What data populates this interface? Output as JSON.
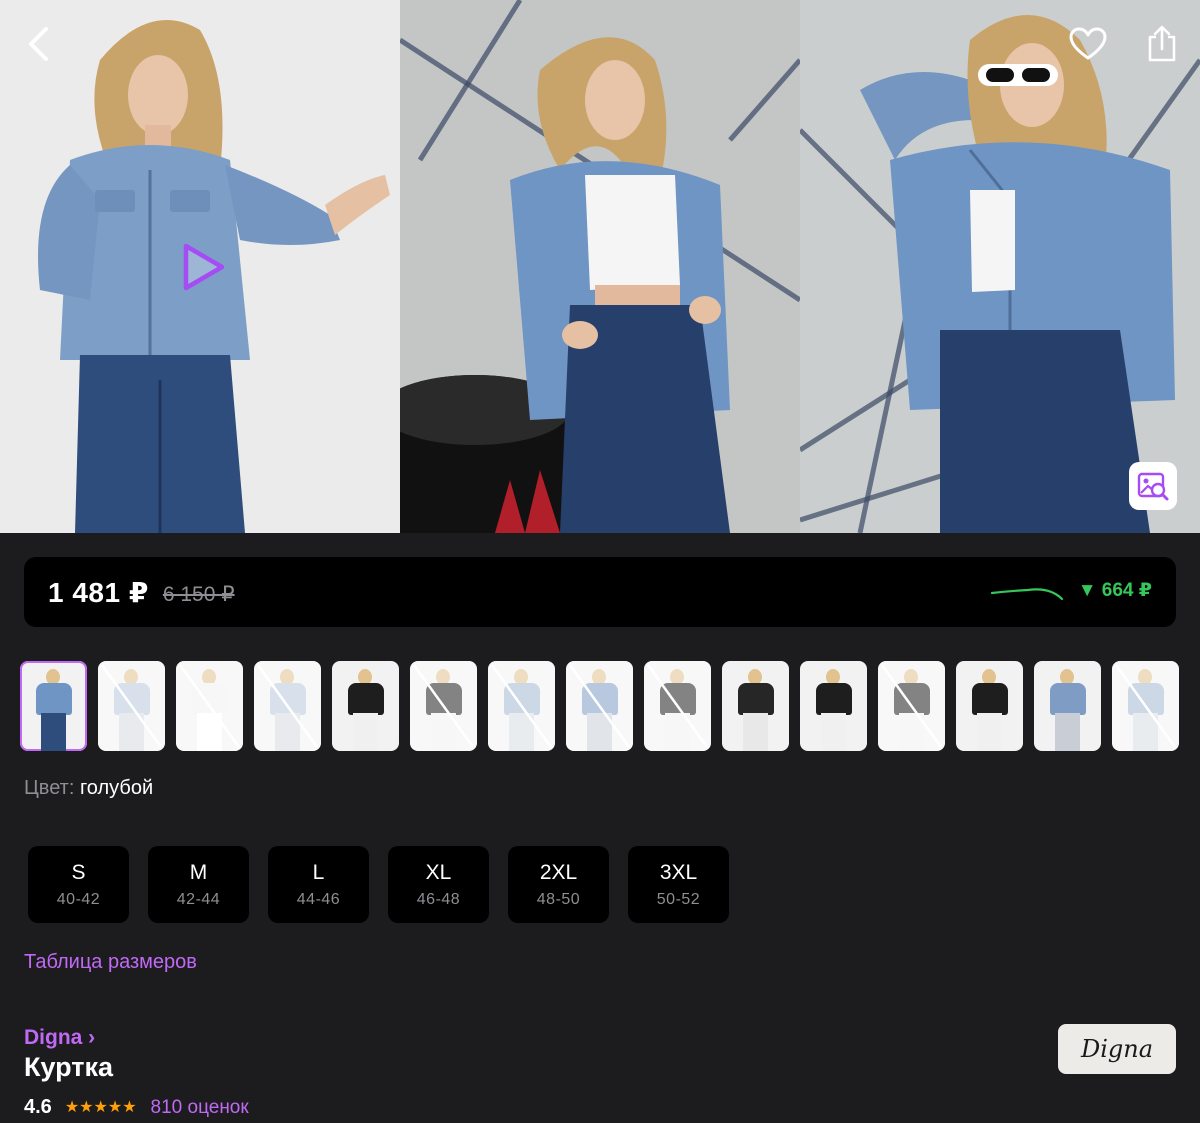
{
  "gallery": {
    "photos": [
      "photo-1",
      "photo-2",
      "photo-3"
    ],
    "icons": {
      "back": "chevron-left-icon",
      "favorite": "heart-icon",
      "share": "share-icon",
      "play": "play-icon",
      "visual_search": "image-search-icon"
    }
  },
  "price": {
    "current": "1 481 ₽",
    "old": "6 150 ₽",
    "drop": "▼ 664 ₽",
    "trend_icon": "price-trend-sparkline",
    "drop_color": "#34c759"
  },
  "colors": {
    "label": "Цвет:",
    "value": "голубой",
    "thumbnails": [
      {
        "variant": "blue-denim",
        "available": true,
        "selected": true
      },
      {
        "variant": "light-blue",
        "available": false
      },
      {
        "variant": "white",
        "available": false
      },
      {
        "variant": "light-blue",
        "available": false
      },
      {
        "variant": "black",
        "available": true
      },
      {
        "variant": "black",
        "available": false
      },
      {
        "variant": "light-denim",
        "available": false
      },
      {
        "variant": "denim",
        "available": false
      },
      {
        "variant": "black",
        "available": false
      },
      {
        "variant": "black-hooded",
        "available": true
      },
      {
        "variant": "black",
        "available": true
      },
      {
        "variant": "black",
        "available": false
      },
      {
        "variant": "black",
        "available": true
      },
      {
        "variant": "denim",
        "available": true
      },
      {
        "variant": "light-denim",
        "available": false
      }
    ]
  },
  "sizes": [
    {
      "name": "S",
      "range": "40-42"
    },
    {
      "name": "M",
      "range": "42-44"
    },
    {
      "name": "L",
      "range": "44-46"
    },
    {
      "name": "XL",
      "range": "46-48"
    },
    {
      "name": "2XL",
      "range": "48-50"
    },
    {
      "name": "3XL",
      "range": "50-52"
    }
  ],
  "size_table_link": "Таблица размеров",
  "product": {
    "brand": "Digna ›",
    "name": "Куртка",
    "rating": "4.6",
    "stars": "★★★★★",
    "reviews": "810 оценок",
    "brand_logo_text": "Digna"
  },
  "theme": {
    "accent": "#c069f5",
    "background": "#1c1c1e",
    "card": "#000000",
    "star": "#ff9f0a"
  }
}
